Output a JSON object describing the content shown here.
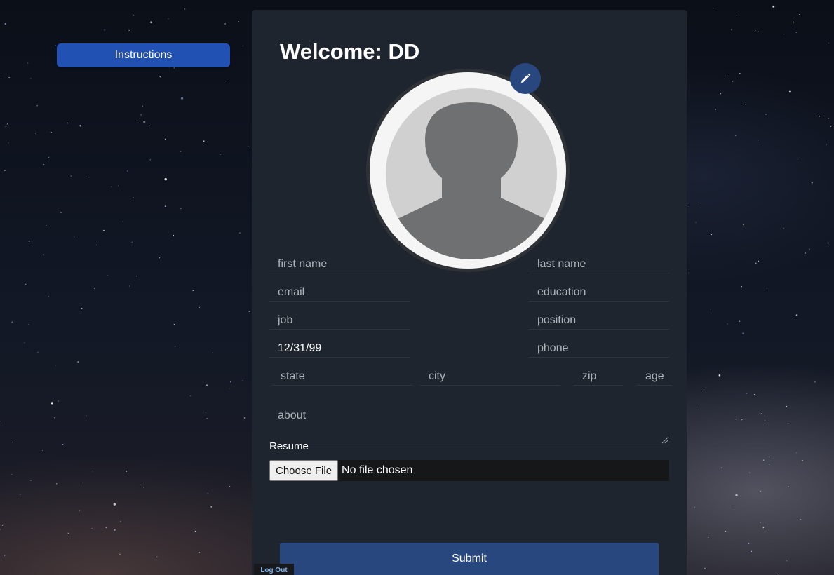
{
  "sidebar": {
    "instructions_label": "Instructions"
  },
  "header": {
    "title": "Welcome: DD"
  },
  "avatar": {
    "edit_icon": "pencil-icon"
  },
  "form": {
    "first_name": {
      "placeholder": "first name",
      "value": ""
    },
    "last_name": {
      "placeholder": "last name",
      "value": ""
    },
    "email": {
      "placeholder": "email",
      "value": ""
    },
    "education": {
      "placeholder": "education",
      "value": ""
    },
    "job": {
      "placeholder": "job",
      "value": ""
    },
    "position": {
      "placeholder": "position",
      "value": ""
    },
    "birthday": {
      "placeholder": "",
      "value": "12/31/99"
    },
    "phone": {
      "placeholder": "phone",
      "value": ""
    },
    "state": {
      "placeholder": "state",
      "value": ""
    },
    "city": {
      "placeholder": "city",
      "value": ""
    },
    "zip": {
      "placeholder": "zip",
      "value": ""
    },
    "age": {
      "placeholder": "age",
      "value": ""
    },
    "about": {
      "placeholder": "about",
      "value": ""
    },
    "resume_label": "Resume",
    "choose_file_label": "Choose File",
    "file_status": "No file chosen",
    "submit_label": "Submit"
  },
  "footer": {
    "logout_label": "Log Out"
  },
  "colors": {
    "primary_button": "#2152b3",
    "submit_button": "#28477f",
    "panel_bg": "#1f252f",
    "logout_text": "#7fb3ee"
  }
}
